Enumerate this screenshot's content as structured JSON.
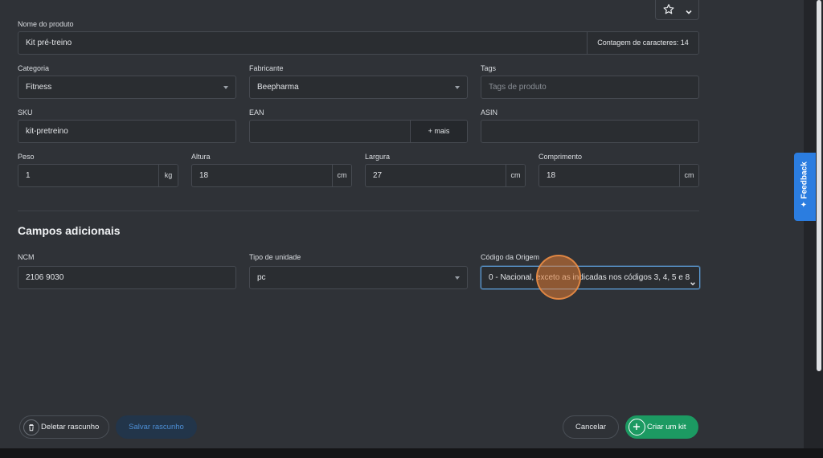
{
  "header": {
    "star_icon": "star-icon",
    "chevron_icon": "chevron-down-icon"
  },
  "product": {
    "name_label": "Nome do produto",
    "name_value": "Kit pré-treino",
    "char_count": "Contagem de caracteres: 14"
  },
  "category": {
    "label": "Categoria",
    "value": "Fitness"
  },
  "manufacturer": {
    "label": "Fabricante",
    "value": "Beepharma"
  },
  "tags": {
    "label": "Tags",
    "placeholder": "Tags de produto"
  },
  "sku": {
    "label": "SKU",
    "value": "kit-pretreino"
  },
  "ean": {
    "label": "EAN",
    "value": "",
    "more": "+ mais"
  },
  "asin": {
    "label": "ASIN",
    "value": ""
  },
  "weight": {
    "label": "Peso",
    "value": "1",
    "unit": "kg"
  },
  "height": {
    "label": "Altura",
    "value": "18",
    "unit": "cm"
  },
  "width": {
    "label": "Largura",
    "value": "27",
    "unit": "cm"
  },
  "length": {
    "label": "Comprimento",
    "value": "18",
    "unit": "cm"
  },
  "additional": {
    "title": "Campos adicionais",
    "ncm_label": "NCM",
    "ncm_value": "2106 9030",
    "unit_type_label": "Tipo de unidade",
    "unit_type_value": "pc",
    "origin_label": "Código da Origem",
    "origin_value": "0 - Nacional, exceto as indicadas nos códigos 3, 4, 5 e 8"
  },
  "feedback": {
    "label": "Feedback"
  },
  "footer": {
    "delete_draft": "Deletar rascunho",
    "save_draft": "Salvar rascunho",
    "cancel": "Cancelar",
    "create": "Criar um kit"
  },
  "colors": {
    "primary": "#1c9a62",
    "accent": "#2b7de0",
    "focus": "#5b9bd5"
  }
}
